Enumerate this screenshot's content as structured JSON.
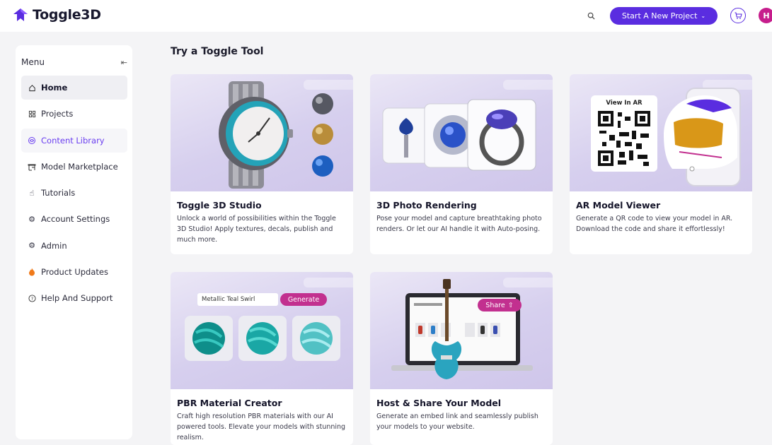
{
  "header": {
    "brand": "Toggle3D",
    "start_project_label": "Start A New Project",
    "avatar_initial": "H",
    "accent": "#5a2de0"
  },
  "sidebar": {
    "menu_title": "Menu",
    "items": [
      {
        "label": "Home",
        "icon": "home-icon"
      },
      {
        "label": "Projects",
        "icon": "grid-icon"
      },
      {
        "label": "Content Library",
        "icon": "library-icon"
      },
      {
        "label": "Model Marketplace",
        "icon": "store-icon"
      },
      {
        "label": "Tutorials",
        "icon": "hand-icon"
      },
      {
        "label": "Account Settings",
        "icon": "gear-icon"
      },
      {
        "label": "Admin",
        "icon": "gear-icon"
      },
      {
        "label": "Product Updates",
        "icon": "flame-icon"
      },
      {
        "label": "Help And Support",
        "icon": "help-icon"
      }
    ]
  },
  "main": {
    "section_title": "Try a Toggle Tool",
    "cards": [
      {
        "title": "Toggle 3D Studio",
        "desc": "Unlock a world of possibilities within the Toggle 3D Studio! Apply textures, decals, publish and much more."
      },
      {
        "title": "3D Photo Rendering",
        "desc": "Pose your model and capture breathtaking photo renders. Or let our AI handle it with Auto-posing."
      },
      {
        "title": "AR Model Viewer",
        "desc": "Generate a QR code to view your model in AR. Download the code and share it effortlessly!",
        "img_label": "View In AR"
      },
      {
        "title": "PBR Material Creator",
        "desc": "Craft high resolution PBR materials with our AI powered tools. Elevate your models with stunning realism.",
        "img_input": "Metallic Teal Swirl",
        "img_button": "Generate"
      },
      {
        "title": "Host & Share Your Model",
        "desc": "Generate an embed link and seamlessly publish your models to your website.",
        "img_button": "Share"
      }
    ]
  }
}
